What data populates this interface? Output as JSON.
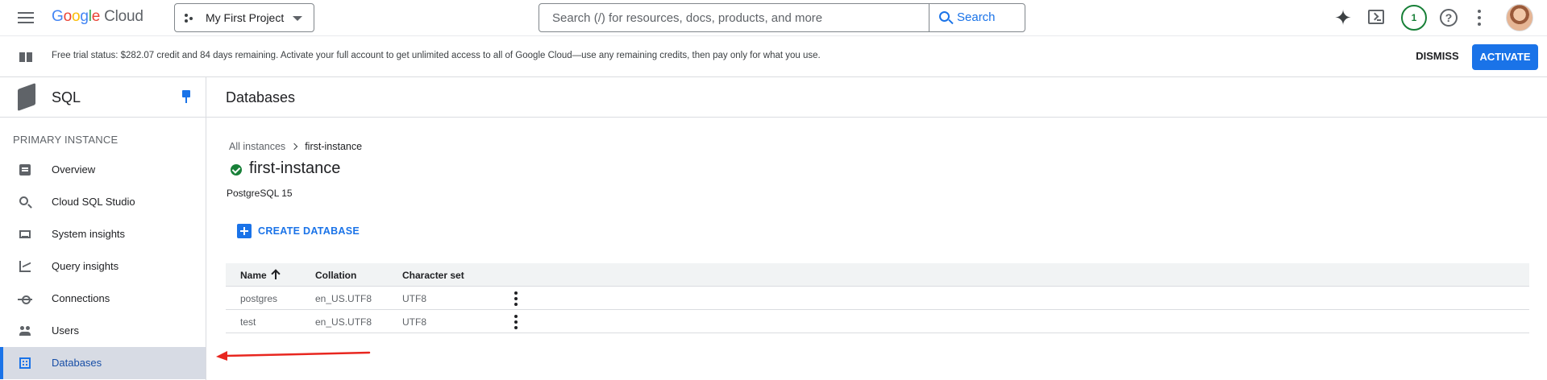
{
  "header": {
    "brand": {
      "letters": [
        "G",
        "o",
        "o",
        "g",
        "l",
        "e"
      ],
      "product": "Cloud"
    },
    "project": "My First Project",
    "search": {
      "placeholder": "Search (/) for resources, docs, products, and more",
      "button": "Search"
    },
    "notification_count": "1",
    "help_glyph": "?",
    "sparkle_glyph": "✦",
    "icons": [
      "menu-icon",
      "sparkle-icon",
      "terminal-icon",
      "help-icon",
      "more-vert-icon",
      "avatar"
    ]
  },
  "banner": {
    "text": "Free trial status: $282.07 credit and 84 days remaining. Activate your full account to get unlimited access to all of Google Cloud—use any remaining credits, then pay only for what you use.",
    "dismiss": "DISMISS",
    "activate": "ACTIVATE"
  },
  "sidebar": {
    "title": "SQL",
    "section": "PRIMARY INSTANCE",
    "items": [
      {
        "label": "Overview",
        "icon": "overview-icon"
      },
      {
        "label": "Cloud SQL Studio",
        "icon": "search-icon"
      },
      {
        "label": "System insights",
        "icon": "system-insights-icon"
      },
      {
        "label": "Query insights",
        "icon": "query-insights-icon"
      },
      {
        "label": "Connections",
        "icon": "connections-icon"
      },
      {
        "label": "Users",
        "icon": "users-icon"
      },
      {
        "label": "Databases",
        "icon": "databases-icon",
        "active": true
      }
    ]
  },
  "main": {
    "title": "Databases",
    "breadcrumb": {
      "parent": "All instances",
      "current": "first-instance"
    },
    "instance": {
      "name": "first-instance",
      "status": "running",
      "version": "PostgreSQL 15"
    },
    "create_button": "CREATE DATABASE",
    "table": {
      "columns": [
        "Name",
        "Collation",
        "Character set"
      ],
      "sort": {
        "column": "Name",
        "direction": "ascending"
      },
      "rows": [
        {
          "name": "postgres",
          "collation": "en_US.UTF8",
          "charset": "UTF8"
        },
        {
          "name": "test",
          "collation": "en_US.UTF8",
          "charset": "UTF8"
        }
      ]
    }
  },
  "colors": {
    "accent": "#1a73e8",
    "active_nav_bg": "#d7dbe4",
    "status_ok": "#188038",
    "annotation_arrow": "#e8261f"
  }
}
